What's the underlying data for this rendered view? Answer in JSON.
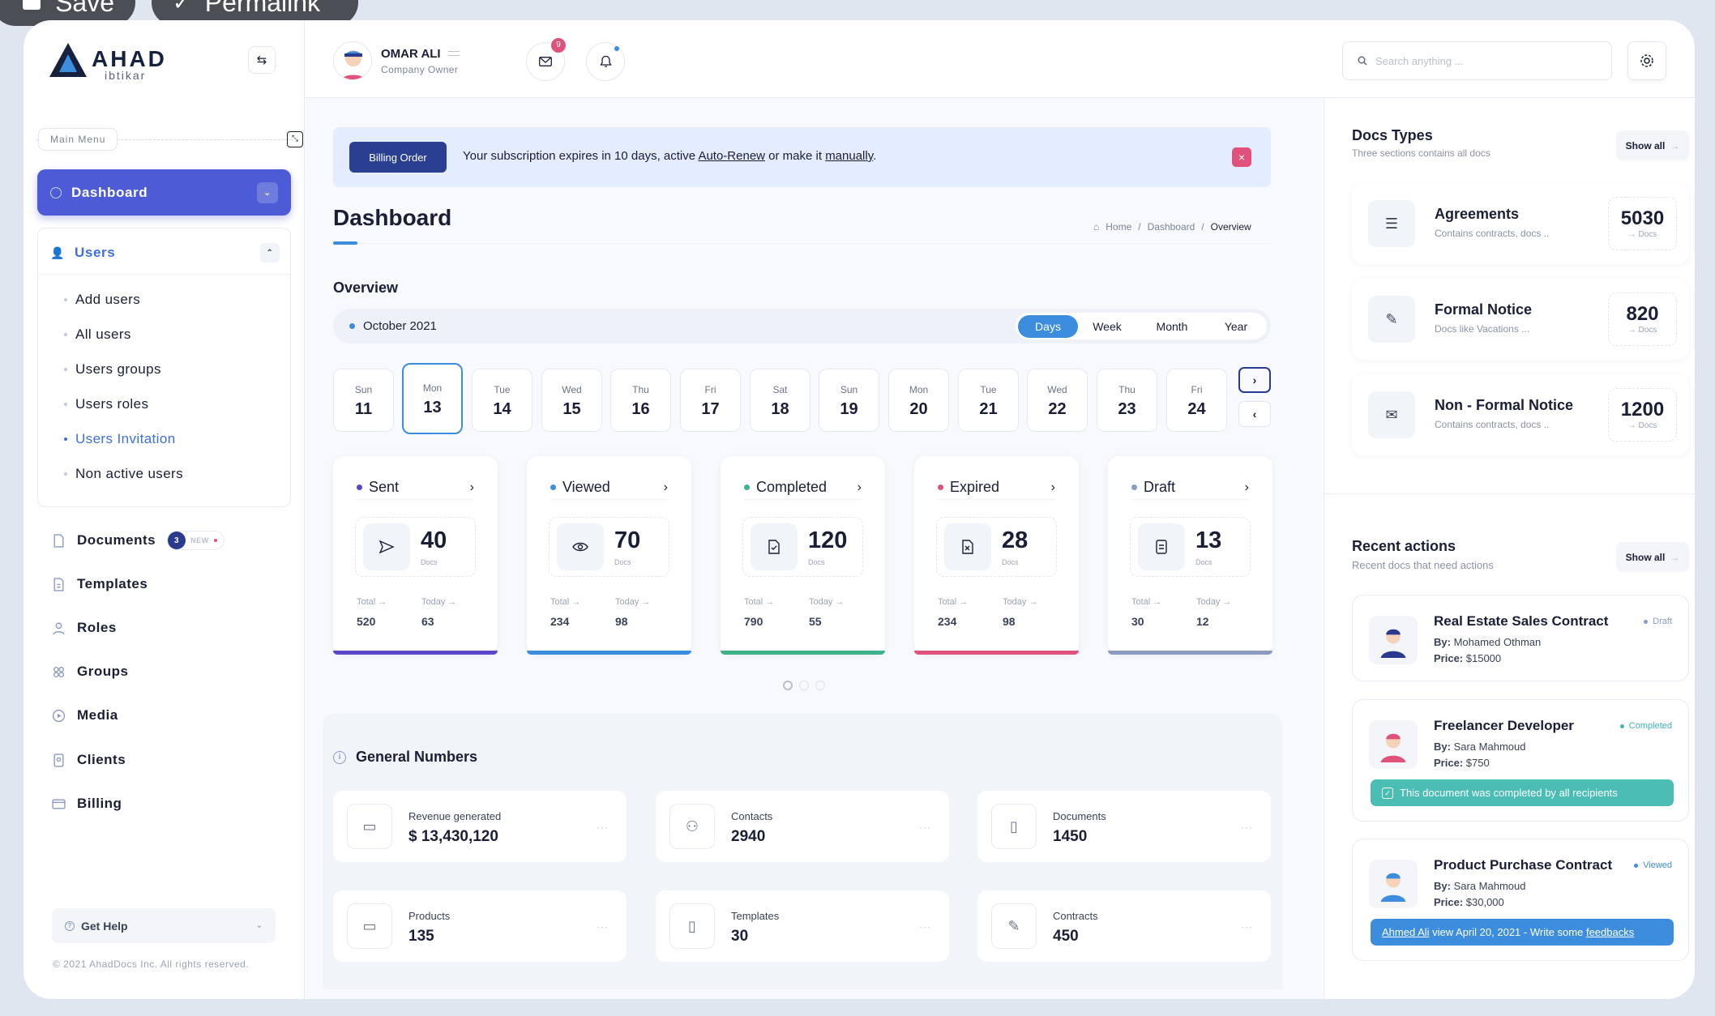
{
  "top_actions": {
    "save": "Save",
    "permalink": "Permalink"
  },
  "brand": {
    "name": "AHAD",
    "sub": "ibtikar"
  },
  "sidebar": {
    "section": "Main Menu",
    "dashboard": "Dashboard",
    "users": "Users",
    "users_sub": [
      "Add users",
      "All users",
      "Users groups",
      "Users roles",
      "Users Invitation",
      "Non active users"
    ],
    "documents": "Documents",
    "documents_badge": "3",
    "documents_new": "NEW",
    "templates": "Templates",
    "roles": "Roles",
    "groups": "Groups",
    "media": "Media",
    "clients": "Clients",
    "billing": "Billing",
    "help": "Get Help",
    "copyright": "© 2021 AhadDocs Inc. All rights reserved."
  },
  "user": {
    "name": "OMAR ALI",
    "role": "Company Owner",
    "mail_count": "9"
  },
  "search": {
    "placeholder": "Search anything ..."
  },
  "alert": {
    "button": "Billing Order",
    "text1": "Your subscription expires in 10 days, active ",
    "link1": "Auto-Renew",
    "text2": " or make it ",
    "link2": "manually",
    "text3": "."
  },
  "page": {
    "title": "Dashboard",
    "crumb_home": "Home",
    "crumb_dash": "Dashboard",
    "crumb_current": "Overview",
    "overview": "Overview",
    "month": "October 2021"
  },
  "periods": [
    "Days",
    "Week",
    "Month",
    "Year"
  ],
  "days": [
    {
      "n": "Sun",
      "d": "11"
    },
    {
      "n": "Mon",
      "d": "13"
    },
    {
      "n": "Tue",
      "d": "14"
    },
    {
      "n": "Wed",
      "d": "15"
    },
    {
      "n": "Thu",
      "d": "16"
    },
    {
      "n": "Fri",
      "d": "17"
    },
    {
      "n": "Sat",
      "d": "18"
    },
    {
      "n": "Sun",
      "d": "19"
    },
    {
      "n": "Mon",
      "d": "20"
    },
    {
      "n": "Tue",
      "d": "21"
    },
    {
      "n": "Wed",
      "d": "22"
    },
    {
      "n": "Thu",
      "d": "23"
    },
    {
      "n": "Fri",
      "d": "24"
    }
  ],
  "stats": [
    {
      "label": "Sent",
      "value": "40",
      "docs": "Docs",
      "total_l": "Total",
      "today_l": "Today",
      "total": "520",
      "today": "63",
      "color": "#5b46c9"
    },
    {
      "label": "Viewed",
      "value": "70",
      "docs": "Docs",
      "total_l": "Total",
      "today_l": "Today",
      "total": "234",
      "today": "98",
      "color": "#3d8ddf"
    },
    {
      "label": "Completed",
      "value": "120",
      "docs": "Docs",
      "total_l": "Total",
      "today_l": "Today",
      "total": "790",
      "today": "55",
      "color": "#3fb28a"
    },
    {
      "label": "Expired",
      "value": "28",
      "docs": "Docs",
      "total_l": "Total",
      "today_l": "Today",
      "total": "234",
      "today": "98",
      "color": "#e0527c"
    },
    {
      "label": "Draft",
      "value": "13",
      "docs": "Docs",
      "total_l": "Total",
      "today_l": "Today",
      "total": "30",
      "today": "12",
      "color": "#8b9bc0"
    }
  ],
  "general": {
    "title": "General Numbers",
    "items": [
      {
        "label": "Revenue generated",
        "value": "$ 13,430,120"
      },
      {
        "label": "Contacts",
        "value": "2940"
      },
      {
        "label": "Documents",
        "value": "1450"
      },
      {
        "label": "Products",
        "value": "135"
      },
      {
        "label": "Templates",
        "value": "30"
      },
      {
        "label": "Contracts",
        "value": "450"
      }
    ]
  },
  "doc_types": {
    "title": "Docs Types",
    "sub": "Three sections contains all docs",
    "show_all": "Show all",
    "items": [
      {
        "title": "Agreements",
        "sub": "Contains contracts, docs ..",
        "value": "5030",
        "unit": "Docs"
      },
      {
        "title": "Formal Notice",
        "sub": "Docs like Vacations ...",
        "value": "820",
        "unit": "Docs"
      },
      {
        "title": "Non - Formal Notice",
        "sub": "Contains contracts, docs ..",
        "value": "1200",
        "unit": "Docs"
      }
    ]
  },
  "recent": {
    "title": "Recent actions",
    "sub": "Recent docs that need actions",
    "show_all": "Show all",
    "items": [
      {
        "title": "Real Estate Sales Contract",
        "by_l": "By:",
        "by": "Mohamed Othman",
        "price_l": "Price:",
        "price": "$15000",
        "status": "Draft",
        "status_color": "#8b9bc0"
      },
      {
        "title": "Freelancer Developer",
        "by_l": "By:",
        "by": "Sara Mahmoud",
        "price_l": "Price:",
        "price": "$750",
        "status": "Completed",
        "status_color": "#3fb2b8",
        "note": "This document was completed by all recipients"
      },
      {
        "title": "Product Purchase Contract",
        "by_l": "By:",
        "by": "Sara Mahmoud",
        "price_l": "Price:",
        "price": "$30,000",
        "status": "Viewed",
        "status_color": "#3d8ddf",
        "note_link": "Ahmed Ali",
        "note_mid": " view April 20, 2021 - Write some ",
        "note_link2": "feedbacks"
      }
    ]
  }
}
